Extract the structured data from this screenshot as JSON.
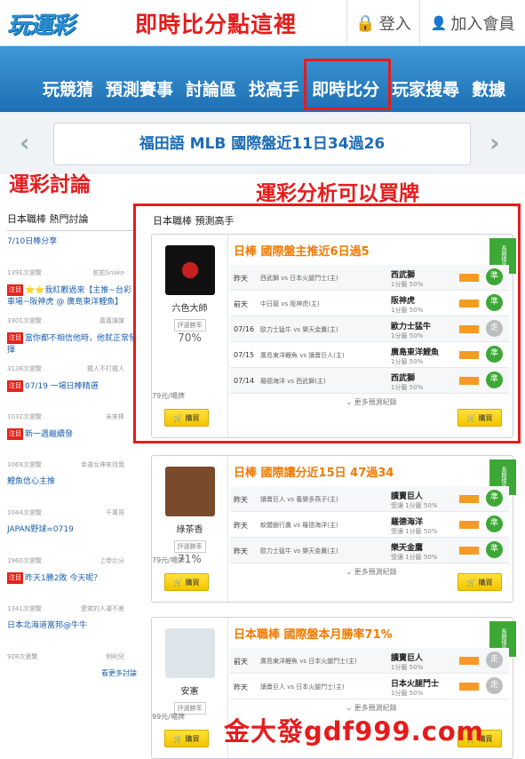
{
  "header": {
    "logo": "玩運彩",
    "live_link": "即時比分點這裡",
    "login": "登入",
    "join": "加入會員"
  },
  "nav": {
    "items": [
      "玩競猜",
      "預測賽事",
      "討論區",
      "找高手",
      "即時比分",
      "玩家搜尋",
      "數據"
    ]
  },
  "banner": {
    "text": "福田語 MLB 國際盤近11日34過26"
  },
  "annotations": {
    "discussion": "運彩討論",
    "analysis": "運彩分析可以買牌",
    "promo": "金大發gdf999.com"
  },
  "sidebar": {
    "title": "日本職棒 熱門討論",
    "more": "看更多討論",
    "items": [
      {
        "tag": "",
        "title": "7/10日棒分享",
        "views": "1391次瀏覽",
        "author": "蛇蛇Snake"
      },
      {
        "tag": "注目",
        "title": "⭐⭐我紅觀過來【主推~台彩車場~阪神虎 @ 廣島東洋鯉魚】",
        "views": "3301次瀏覽",
        "author": "義義謀謀"
      },
      {
        "tag": "注目",
        "title": "當你都不相信他時，他就正常發揮",
        "views": "3138次瀏覽",
        "author": "獵人不打獵人"
      },
      {
        "tag": "注目",
        "title": "07/19 一場日棒精選",
        "views": "1032次瀏覽",
        "author": "未來棒"
      },
      {
        "tag": "注目",
        "title": "新一週繼續發",
        "views": "1069次瀏覽",
        "author": "幸運女神來找我"
      },
      {
        "tag": "",
        "title": "鯉魚信心主推",
        "views": "1044次瀏覽",
        "author": "千萬哥"
      },
      {
        "tag": "",
        "title": "JAPAN野球=0719",
        "views": "1960次瀏覽",
        "author": "上帝比分"
      },
      {
        "tag": "注目",
        "title": "昨天1勝2敗 今天呢？",
        "views": "1341次瀏覽",
        "author": "愛笑的人運不差"
      },
      {
        "tag": "",
        "title": "日本北海道富邦@牛牛",
        "views": "928次瀏覽",
        "author": "例則兒"
      }
    ]
  },
  "experts": {
    "section_title": "日本職棒 預測高手",
    "ribbon": "長期穩定",
    "more_label": "更多預測紀錄",
    "buy_label": "購買",
    "rate_label": "評選勝率",
    "cards": [
      {
        "name": "六色大師",
        "rate": "70%",
        "price": "79元/場牌",
        "title": "日棒 國際盤主推近6日過5",
        "rows": [
          {
            "date": "昨天",
            "game": "西武獅 vs 日本火腿鬥士(主)",
            "pick": "西武獅",
            "pick_sub": "1分籤 50%",
            "result": "準"
          },
          {
            "date": "前天",
            "game": "中日龍 vs 阪神虎(主)",
            "pick": "阪神虎",
            "pick_sub": "1分籤 50%",
            "result": "準"
          },
          {
            "date": "07/16",
            "game": "歐力士猛牛 vs 樂天金鷹(主)",
            "pick": "歐力士猛牛",
            "pick_sub": "1分籤 50%",
            "result": "走"
          },
          {
            "date": "07/15",
            "game": "廣島東洋鯉魚 vs 讀賣巨人(主)",
            "pick": "廣島東洋鯉魚",
            "pick_sub": "1分籤 50%",
            "result": "準"
          },
          {
            "date": "07/14",
            "game": "羅德海洋 vs 西武獅(主)",
            "pick": "西武獅",
            "pick_sub": "1分籤 50%",
            "result": "準"
          }
        ]
      },
      {
        "name": "綠茶香",
        "rate": "71%",
        "price": "79元/場牌",
        "title": "日棒 國際讓分近15日 47過34",
        "rows": [
          {
            "date": "昨天",
            "game": "讀賣巨人 vs 養樂多燕子(主)",
            "pick": "讀賣巨人",
            "pick_sub": "受讓 1分籤 50%",
            "result": "準"
          },
          {
            "date": "昨天",
            "game": "軟體銀行鷹 vs 羅德海洋(主)",
            "pick": "羅德海洋",
            "pick_sub": "受讓 1分籤 50%",
            "result": "準"
          },
          {
            "date": "昨天",
            "game": "歐力士猛牛 vs 樂天金鷹(主)",
            "pick": "樂天金鷹",
            "pick_sub": "受讓 1分籤 50%",
            "result": "準"
          }
        ]
      },
      {
        "name": "安憲",
        "rate": "",
        "price": "99元/場牌",
        "title": "日本職棒 國際盤本月勝率71%",
        "rows": [
          {
            "date": "前天",
            "game": "廣島東洋鯉魚 vs 日本火腿鬥士(主)",
            "pick": "讀賣巨人",
            "pick_sub": "1分籤 50%",
            "result": "走"
          },
          {
            "date": "昨天",
            "game": "讀賣巨人 vs 日本火腿鬥士(主)",
            "pick": "日本火腿鬥士",
            "pick_sub": "1分籤 50%",
            "result": "走"
          }
        ]
      }
    ]
  },
  "colors": {
    "nav": "#2b83c6",
    "accent_red": "#e61c1c",
    "orange": "#f07a00",
    "green": "#3da835"
  }
}
